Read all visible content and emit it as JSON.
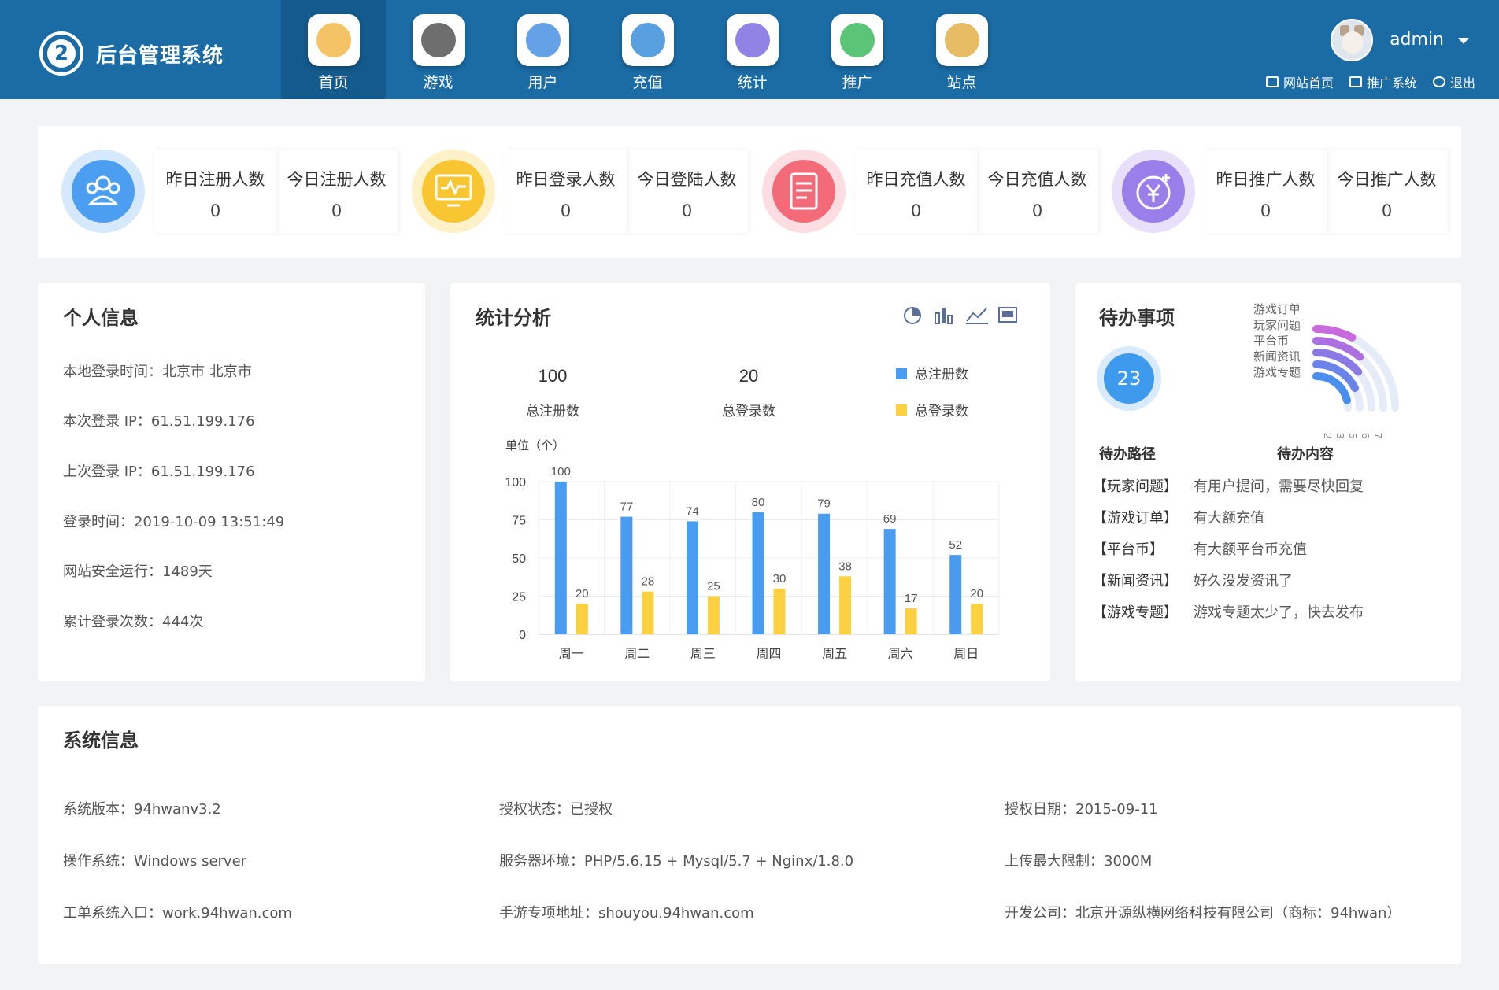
{
  "app": {
    "title": "后台管理系统",
    "logo_glyph": "2"
  },
  "nav": [
    {
      "label": "首页",
      "icon": "home-icon",
      "color": "#f2b84b",
      "active": true
    },
    {
      "label": "游戏",
      "icon": "gamepad-icon",
      "color": "#555555",
      "active": false
    },
    {
      "label": "用户",
      "icon": "user-icon",
      "color": "#4a90e2",
      "active": false
    },
    {
      "label": "充值",
      "icon": "recharge-icon",
      "color": "#3b8fd9",
      "active": false
    },
    {
      "label": "统计",
      "icon": "pie-icon",
      "color": "#7b6ee0",
      "active": false
    },
    {
      "label": "推广",
      "icon": "share-icon",
      "color": "#3dbb5e",
      "active": false
    },
    {
      "label": "站点",
      "icon": "site-icon",
      "color": "#e2b04a",
      "active": false
    }
  ],
  "user": {
    "name": "admin",
    "links": [
      "网站首页",
      "推广系统",
      "退出"
    ]
  },
  "stats": [
    {
      "icon": "users-icon",
      "color": "#4c9ef0",
      "halo": "#d6e8fb",
      "yesterday_label": "昨日注册人数",
      "yesterday": "0",
      "today_label": "今日注册人数",
      "today": "0"
    },
    {
      "icon": "monitor-icon",
      "color": "#f7c631",
      "halo": "#fdf1c8",
      "yesterday_label": "昨日登录人数",
      "yesterday": "0",
      "today_label": "今日登陆人数",
      "today": "0"
    },
    {
      "icon": "document-icon",
      "color": "#f36b78",
      "halo": "#fcdde1",
      "yesterday_label": "昨日充值人数",
      "yesterday": "0",
      "today_label": "今日充值人数",
      "today": "0"
    },
    {
      "icon": "yuan-icon",
      "color": "#9a7ee9",
      "halo": "#e8e0fa",
      "yesterday_label": "昨日推广人数",
      "yesterday": "0",
      "today_label": "今日推广人数",
      "today": "0"
    }
  ],
  "personal": {
    "title": "个人信息",
    "rows": [
      "本地登录时间：北京市 北京市",
      "本次登录 IP：61.51.199.176",
      "上次登录 IP：61.51.199.176",
      "登录时间：2019-10-09 13:51:49",
      "网站安全运行：1489天",
      "累计登录次数：444次"
    ]
  },
  "analysis": {
    "title": "统计分析",
    "total_register": "100",
    "total_register_label": "总注册数",
    "total_login": "20",
    "total_login_label": "总登录数",
    "legend_register": "总注册数",
    "legend_login": "总登录数",
    "unit": "单位（个）"
  },
  "chart_data": {
    "type": "bar",
    "categories": [
      "周一",
      "周二",
      "周三",
      "周四",
      "周五",
      "周六",
      "周日"
    ],
    "series": [
      {
        "name": "总注册数",
        "color": "#4a9cf0",
        "values": [
          100,
          77,
          74,
          80,
          79,
          69,
          52
        ]
      },
      {
        "name": "总登录数",
        "color": "#fbd141",
        "values": [
          20,
          28,
          25,
          30,
          38,
          17,
          20
        ]
      }
    ],
    "ylabel": "单位（个）",
    "yticks": [
      0,
      25,
      50,
      75,
      100
    ],
    "ylim": [
      0,
      100
    ],
    "grid": true,
    "legend": "top-right"
  },
  "todo": {
    "title": "待办事项",
    "count": "23",
    "radial_labels": [
      "游戏订单",
      "玩家问题",
      "平台币",
      "新闻资讯",
      "游戏专题"
    ],
    "radial_ticks": [
      "2",
      "3",
      "5",
      "6",
      "7"
    ],
    "col_path": "待办路径",
    "col_content": "待办内容",
    "items": [
      {
        "path": "【玩家问题】",
        "content": "有用户提问，需要尽快回复"
      },
      {
        "path": "【游戏订单】",
        "content": "有大额充值"
      },
      {
        "path": "【平台币】",
        "content": "有大额平台币充值"
      },
      {
        "path": "【新闻资讯】",
        "content": "好久没发资讯了"
      },
      {
        "path": "【游戏专题】",
        "content": "游戏专题太少了，快去发布"
      }
    ]
  },
  "system": {
    "title": "系统信息",
    "rows": [
      [
        "系统版本：94hwanv3.2",
        "授权状态：已授权",
        "授权日期：2015-09-11"
      ],
      [
        "操作系统：Windows server",
        "服务器环境：PHP/5.6.15 + Mysql/5.7 + Nginx/1.8.0",
        "上传最大限制：3000M"
      ],
      [
        "工单系统入口：work.94hwan.com",
        "手游专项地址：shouyou.94hwan.com",
        "开发公司：北京开源纵横网络科技有限公司（商标：94hwan）"
      ]
    ]
  }
}
